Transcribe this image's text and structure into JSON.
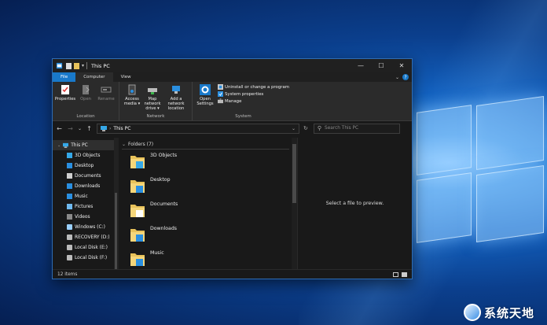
{
  "window": {
    "title": "This PC",
    "controls": {
      "minimize": "—",
      "maximize": "☐",
      "close": "✕"
    }
  },
  "tabs": [
    {
      "label": "File"
    },
    {
      "label": "Computer"
    },
    {
      "label": "View"
    }
  ],
  "ribbon": {
    "location": {
      "label": "Location",
      "buttons": [
        {
          "label": "Properties",
          "icon": "properties-icon"
        },
        {
          "label": "Open",
          "icon": "open-icon"
        },
        {
          "label": "Rename",
          "icon": "rename-icon"
        }
      ]
    },
    "network": {
      "label": "Network",
      "buttons": [
        {
          "label": "Access media ▾",
          "icon": "access-media-icon"
        },
        {
          "label": "Map network drive ▾",
          "icon": "map-drive-icon"
        },
        {
          "label": "Add a network location",
          "icon": "network-location-icon"
        }
      ]
    },
    "system": {
      "label": "System",
      "open_settings": "Open Settings",
      "items": [
        {
          "label": "Uninstall or change a program"
        },
        {
          "label": "System properties"
        },
        {
          "label": "Manage"
        }
      ]
    }
  },
  "address": {
    "path": "This PC",
    "search_placeholder": "Search This PC"
  },
  "nav_pane": {
    "root": "This PC",
    "items": [
      {
        "label": "3D Objects",
        "color": "#35a8e8"
      },
      {
        "label": "Desktop",
        "color": "#2a8fe0"
      },
      {
        "label": "Documents",
        "color": "#cfcfcf"
      },
      {
        "label": "Downloads",
        "color": "#2a8fe0"
      },
      {
        "label": "Music",
        "color": "#2a8fe0"
      },
      {
        "label": "Pictures",
        "color": "#6fb9ef"
      },
      {
        "label": "Videos",
        "color": "#8a8a8a"
      },
      {
        "label": "Windows (C:)",
        "color": "#9ad0ff"
      },
      {
        "label": "RECOVERY (D:)",
        "color": "#bbbbbb"
      },
      {
        "label": "Local Disk (E:)",
        "color": "#bbbbbb"
      },
      {
        "label": "Local Disk (F:)",
        "color": "#bbbbbb"
      }
    ]
  },
  "content": {
    "group_header": "Folders (7)",
    "folders": [
      {
        "label": "3D Objects"
      },
      {
        "label": "Desktop"
      },
      {
        "label": "Documents"
      },
      {
        "label": "Downloads"
      },
      {
        "label": "Music"
      }
    ]
  },
  "preview_text": "Select a file to preview.",
  "status": {
    "items": "12 items"
  },
  "watermark": {
    "text": "系统天地"
  },
  "colors": {
    "accent": "#1979ca",
    "folder": "#e8c25a"
  }
}
